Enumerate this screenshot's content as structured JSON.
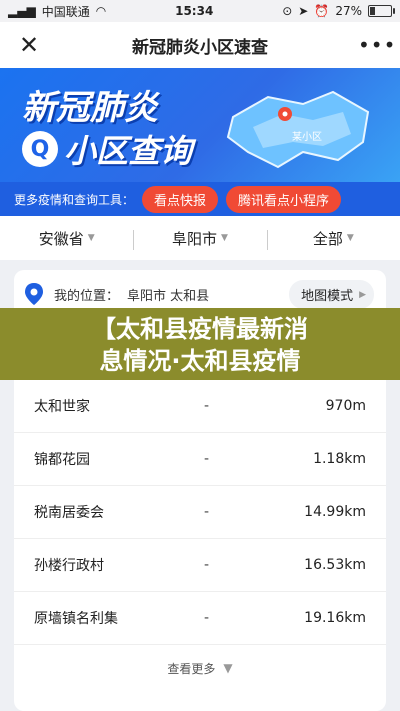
{
  "status_bar": {
    "carrier": "中国联通",
    "time": "15:34",
    "battery_percent": "27%",
    "battery_level": 0.27
  },
  "header": {
    "title": "新冠肺炎小区速查",
    "close_icon": "close-icon",
    "more_icon": "more-icon"
  },
  "banner": {
    "line1": "新冠肺炎",
    "line2": "小区查询",
    "map_label": "某小区"
  },
  "tools": {
    "label": "更多疫情和查询工具：",
    "btn1": "看点快报",
    "btn2": "腾讯看点小程序"
  },
  "filters": [
    "安徽省",
    "阜阳市",
    "全部"
  ],
  "location": {
    "label": "我的位置：",
    "value": "阜阳市 太和县",
    "map_mode": "地图模式"
  },
  "overlay": {
    "line1": "【太和县疫情最新消",
    "line2": "息情况·太和县疫情"
  },
  "rows": [
    {
      "name": "太和世家",
      "dash": "-",
      "dist": "970m"
    },
    {
      "name": "锦都花园",
      "dash": "-",
      "dist": "1.18km"
    },
    {
      "name": "税南居委会",
      "dash": "-",
      "dist": "14.99km"
    },
    {
      "name": "孙楼行政村",
      "dash": "-",
      "dist": "16.53km"
    },
    {
      "name": "原墙镇名利集",
      "dash": "-",
      "dist": "19.16km"
    }
  ],
  "see_more": "查看更多",
  "colors": {
    "accent": "#1f5fe0",
    "button": "#f04a35",
    "overlay": "#8b8c2c"
  }
}
